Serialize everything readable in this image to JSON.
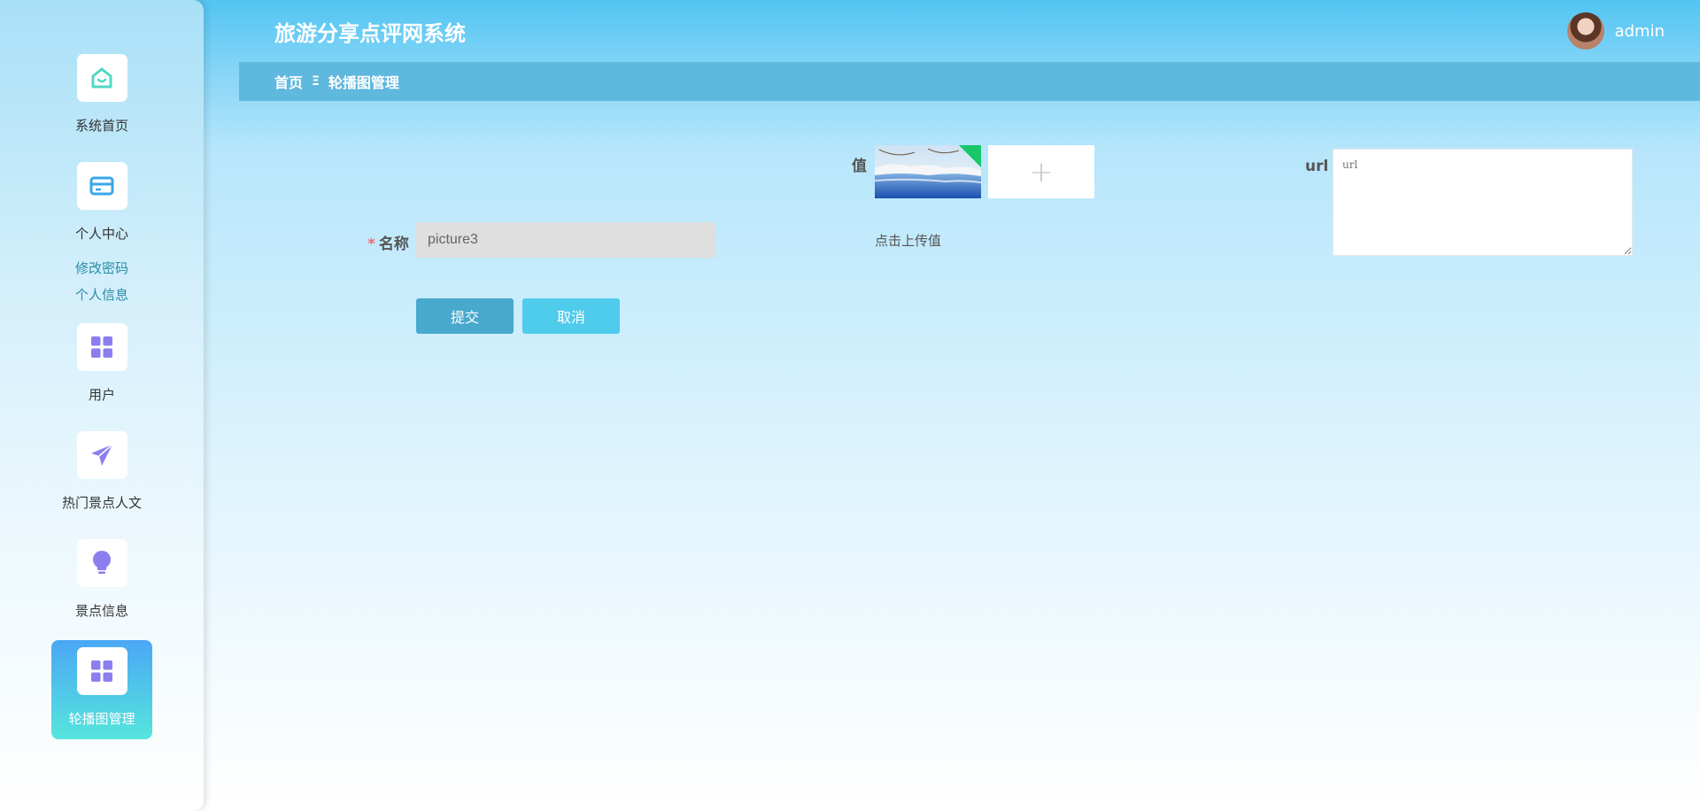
{
  "app": {
    "title": "旅游分享点评网系统"
  },
  "user": {
    "name": "admin"
  },
  "breadcrumb": {
    "home": "首页",
    "separator": "Ξ",
    "current": "轮播图管理"
  },
  "sidebar": {
    "items": [
      {
        "label": "系统首页",
        "icon": "home-icon",
        "color": "#4fd8c4"
      },
      {
        "label": "个人中心",
        "icon": "card-icon",
        "color": "#3aa6e8",
        "subitems": [
          "修改密码",
          "个人信息"
        ]
      },
      {
        "label": "用户",
        "icon": "grid-icon",
        "color": "#8b7ff0"
      },
      {
        "label": "热门景点人文",
        "icon": "paper-plane-icon",
        "color": "#8b7ff0"
      },
      {
        "label": "景点信息",
        "icon": "lightbulb-icon",
        "color": "#8b7ff0"
      },
      {
        "label": "轮播图管理",
        "icon": "grid-icon",
        "color": "#8b7ff0",
        "active": true
      }
    ]
  },
  "form": {
    "name": {
      "label": "名称",
      "required_mark": "*",
      "value": "picture3"
    },
    "value": {
      "label": "值",
      "upload_tip": "点击上传值",
      "upload_icon": "+"
    },
    "url": {
      "label": "url",
      "placeholder": "url"
    },
    "submit_label": "提交",
    "cancel_label": "取消"
  },
  "colors": {
    "primary": "#48a9cd",
    "secondary": "#4fcbec",
    "breadcrumb_bg": "#5fb8dd",
    "required": "#f56c6c"
  }
}
